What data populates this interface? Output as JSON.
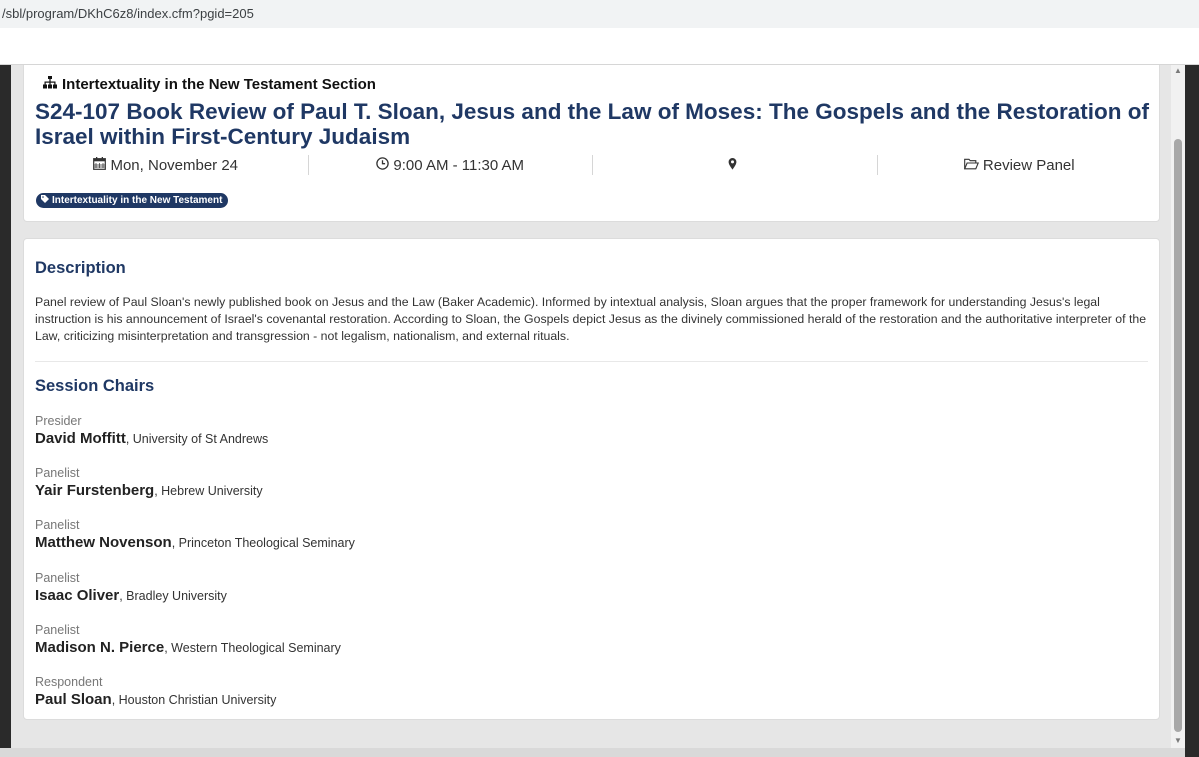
{
  "browser": {
    "url": "/sbl/program/DKhC6z8/index.cfm?pgid=205"
  },
  "session": {
    "section": "Intertextuality in the New Testament Section",
    "title": "S24-107 Book Review of Paul T. Sloan, Jesus and the Law of Moses: The Gospels and the Restoration of Israel within First-Century Judaism",
    "date": "Mon, November 24",
    "time": "9:00 AM - 11:30 AM",
    "location": "",
    "type": "Review Panel",
    "tag": "Intertextuality in the New Testament",
    "accent_color": "#1f3864"
  },
  "description": {
    "heading": "Description",
    "text": "Panel review of Paul Sloan's newly published book on Jesus and the Law (Baker Academic). Informed by intextual analysis, Sloan argues that the proper framework for understanding Jesus's legal instruction is his announcement of Israel's covenantal restoration. According to Sloan, the Gospels depict Jesus as the divinely commissioned herald of the restoration and the authoritative interpreter of the Law, criticizing misinterpretation and transgression - not legalism, nationalism, and external rituals."
  },
  "chairs": {
    "heading": "Session Chairs",
    "items": [
      {
        "role": "Presider",
        "name": "David Moffitt",
        "affiliation": ", University of St Andrews"
      },
      {
        "role": "Panelist",
        "name": "Yair Furstenberg",
        "affiliation": ", Hebrew University"
      },
      {
        "role": "Panelist",
        "name": "Matthew Novenson",
        "affiliation": ", Princeton Theological Seminary"
      },
      {
        "role": "Panelist",
        "name": "Isaac Oliver",
        "affiliation": ", Bradley University"
      },
      {
        "role": "Panelist",
        "name": "Madison N. Pierce",
        "affiliation": ", Western Theological Seminary"
      },
      {
        "role": "Respondent",
        "name": "Paul Sloan",
        "affiliation": ", Houston Christian University"
      }
    ]
  },
  "icons": {
    "section": "sitemap-icon",
    "date": "calendar-icon",
    "time": "clock-icon",
    "location": "map-marker-icon",
    "type": "folder-open-icon",
    "tag": "tag-icon"
  }
}
